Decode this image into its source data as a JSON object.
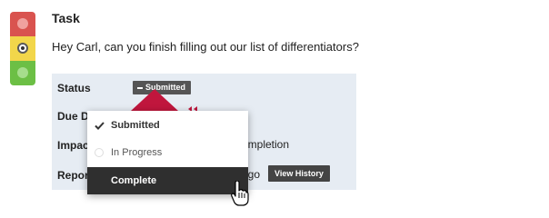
{
  "task": {
    "title": "Task",
    "message": "Hey Carl, can you finish filling out our list of differentiators?"
  },
  "traffic_light": {
    "selected": "yellow",
    "colors": {
      "red": "#d9534f",
      "yellow": "#f2d64a",
      "green": "#6cbf45"
    }
  },
  "details": {
    "status_label": "Status",
    "status_value": "Submitted",
    "due_label": "Due Da",
    "impact_label": "Impact",
    "impact_partial": "ompletion",
    "report_label": "Report",
    "report_partial": "ago",
    "view_history_label": "View History"
  },
  "status_menu": {
    "options": [
      {
        "label": "Submitted",
        "icon": "checkmark-icon",
        "selected": true
      },
      {
        "label": "In Progress",
        "icon": "circle-icon",
        "selected": false
      },
      {
        "label": "Complete",
        "icon": "none",
        "selected": false,
        "hovered": true
      }
    ]
  },
  "accent": {
    "red_marker": "#c0163d",
    "badge": "#555555",
    "menu_hover": "#2f2f2f"
  }
}
